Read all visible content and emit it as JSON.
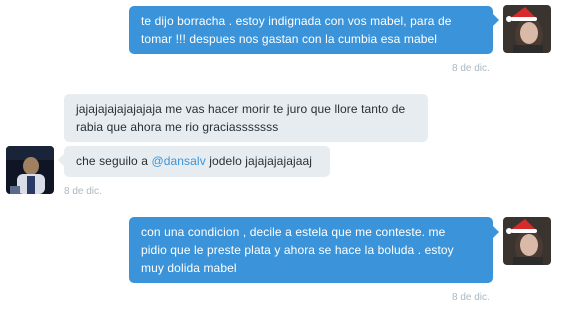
{
  "conversation": {
    "messages": [
      {
        "direction": "outgoing",
        "lines": [
          "te dijo borracha . estoy indignada con vos mabel, para de",
          "tomar !!! despues nos gastan con la cumbia esa mabel"
        ],
        "timestamp": "8 de dic."
      },
      {
        "direction": "incoming",
        "lines": [
          "jajajajajajajajaja me vas hacer morir te juro que llore tanto de",
          "rabia que ahora me rio graciasssssss"
        ],
        "mention_line": {
          "before": "che seguilo a ",
          "mention": "@dansalv",
          "after": " jodelo jajajajajajaaj"
        },
        "timestamp": "8 de dic."
      },
      {
        "direction": "outgoing",
        "lines": [
          "con una condicion , decile a estela que me conteste. me",
          "pidio que le preste plata y ahora se hace la boluda . estoy",
          "muy dolida mabel"
        ],
        "timestamp": "8 de dic."
      }
    ]
  },
  "colors": {
    "outgoing_bubble": "#3b94d9",
    "incoming_bubble": "#e6ecf0",
    "mention": "#3b94d9",
    "timestamp": "#aab8c2"
  },
  "icons": {
    "outgoing_avatar": "user-avatar-santa-hat",
    "incoming_avatar": "user-avatar"
  }
}
